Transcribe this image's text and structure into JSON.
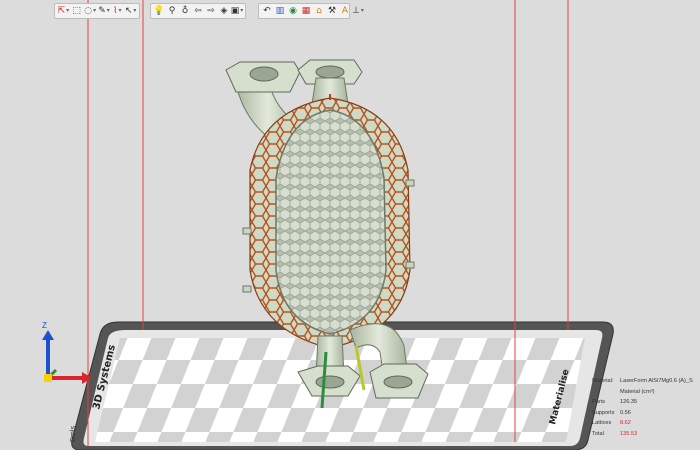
{
  "toolbar_left": {
    "buttons": [
      {
        "name": "select-tool-icon",
        "glyph": "⇱"
      },
      {
        "name": "select-box-icon",
        "glyph": "⬚"
      },
      {
        "name": "lasso-icon",
        "glyph": "◌"
      },
      {
        "name": "mark-tool-icon",
        "glyph": "✎"
      },
      {
        "name": "brush-icon",
        "glyph": "⌇"
      },
      {
        "name": "cursor-icon",
        "glyph": "↖"
      }
    ]
  },
  "toolbar_middle": {
    "buttons": [
      {
        "name": "lightbulb-icon",
        "glyph": "💡"
      },
      {
        "name": "pin-icon",
        "glyph": "⚲"
      },
      {
        "name": "bulb-outline-icon",
        "glyph": "♁"
      },
      {
        "name": "arrow-left-icon",
        "glyph": "⇦"
      },
      {
        "name": "arrow-right-icon",
        "glyph": "⇨"
      },
      {
        "name": "view-cube-icon",
        "glyph": "◈"
      },
      {
        "name": "camera-icon",
        "glyph": "▣"
      }
    ]
  },
  "toolbar_right": {
    "buttons": [
      {
        "name": "undo-icon",
        "glyph": "↶"
      },
      {
        "name": "support-icon",
        "glyph": "▥"
      },
      {
        "name": "part-icon",
        "glyph": "◉"
      },
      {
        "name": "hatch-icon",
        "glyph": "▦"
      },
      {
        "name": "house-icon",
        "glyph": "⌂"
      },
      {
        "name": "wrench-icon",
        "glyph": "⚒"
      },
      {
        "name": "label-icon",
        "glyph": "A"
      },
      {
        "name": "axis-icon",
        "glyph": "⊥"
      }
    ]
  },
  "platform": {
    "front_label": "Materialise",
    "side_label": "3D Systems",
    "corner_label": "Dmls"
  },
  "axes": {
    "z_label": "Z"
  },
  "stats": {
    "material_key": "Material:",
    "material_val": "LaserForm AlSi7Mg0.6 (A)_S",
    "unit_label": "Material (cm³)",
    "parts_key": "Parts",
    "parts_val": "126.35",
    "supports_key": "Supports",
    "supports_val": "0.56",
    "lattices_key": "Lattices",
    "lattices_val": "8.62",
    "total_key": "Total",
    "total_val": "135.53"
  },
  "colors": {
    "background": "#dcdcdc",
    "part": "#c9d5c0",
    "lattice": "#b5541d",
    "build_box": "#e84040"
  }
}
